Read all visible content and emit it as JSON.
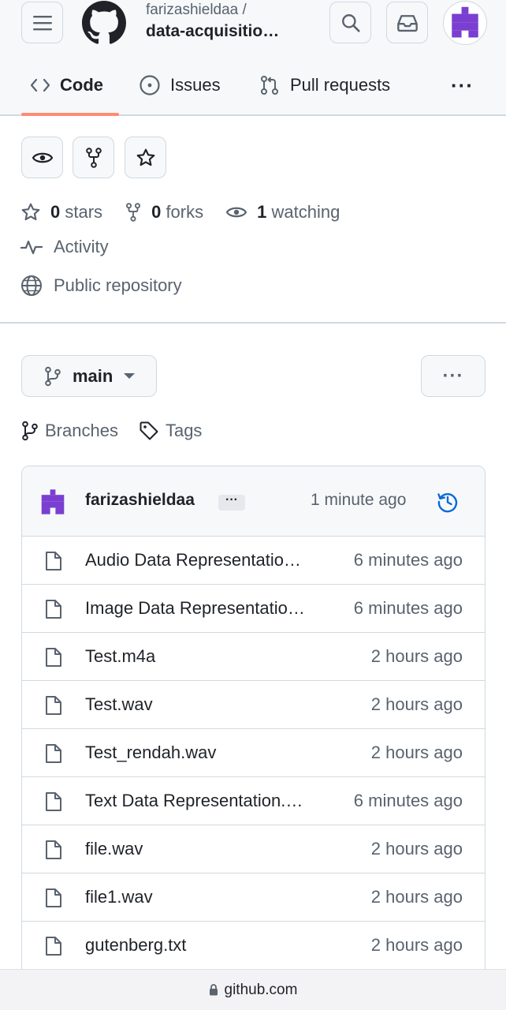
{
  "header": {
    "owner": "farizashieldaa /",
    "repo": "data-acquisitio…",
    "icons": {
      "menu": "hamburger-icon",
      "logo": "github-logo",
      "search": "search-icon",
      "inbox": "inbox-icon"
    }
  },
  "tabs": [
    {
      "label": "Code",
      "icon": "code-icon",
      "active": true
    },
    {
      "label": "Issues",
      "icon": "issue-icon"
    },
    {
      "label": "Pull requests",
      "icon": "pull-request-icon"
    },
    {
      "label": "···",
      "icon": "more-icon"
    }
  ],
  "stats": {
    "stars_count": "0",
    "stars_label": "stars",
    "forks_count": "0",
    "forks_label": "forks",
    "watching_count": "1",
    "watching_label": "watching"
  },
  "activity_label": "Activity",
  "visibility_label": "Public repository",
  "branch": {
    "name": "main"
  },
  "more_label": "···",
  "links": {
    "branches": "Branches",
    "tags": "Tags"
  },
  "commit": {
    "author": "farizashieldaa",
    "ellipsis": "···",
    "time": "1 minute ago"
  },
  "files": [
    {
      "name": "Audio Data Representatio…",
      "time": "6 minutes ago"
    },
    {
      "name": "Image Data Representatio…",
      "time": "6 minutes ago"
    },
    {
      "name": "Test.m4a",
      "time": "2 hours ago"
    },
    {
      "name": "Test.wav",
      "time": "2 hours ago"
    },
    {
      "name": "Test_rendah.wav",
      "time": "2 hours ago"
    },
    {
      "name": "Text Data Representation.…",
      "time": "6 minutes ago"
    },
    {
      "name": "file.wav",
      "time": "2 hours ago"
    },
    {
      "name": "file1.wav",
      "time": "2 hours ago"
    },
    {
      "name": "gutenberg.txt",
      "time": "2 hours ago"
    },
    {
      "name": "",
      "time": ""
    }
  ],
  "url": "github.com",
  "colors": {
    "accent": "#fd8c73",
    "avatar": "#7a3fd1",
    "history": "#0969da"
  }
}
